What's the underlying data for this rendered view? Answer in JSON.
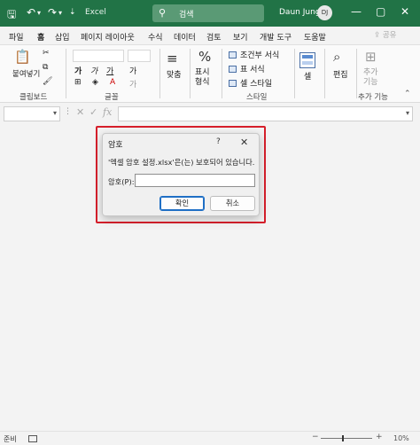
{
  "titlebar": {
    "app_name": "Excel",
    "search_placeholder": "검색",
    "user_name": "Daun Jung",
    "avatar_initials": "DJ"
  },
  "menu": {
    "items": [
      "파일",
      "홈",
      "삽입",
      "페이지 레이아웃",
      "수식",
      "데이터",
      "검토",
      "보기",
      "개발 도구",
      "도움말"
    ],
    "active": "홈",
    "share_label": "공유"
  },
  "ribbon": {
    "paste_label": "붙여넣기",
    "clipboard_label": "클립보드",
    "font_group_label": "글꼴",
    "font_buttons": [
      "가",
      "가",
      "가",
      "가"
    ],
    "align_label": "맞춤",
    "number_label": "표시 형식",
    "styles": [
      "조건부 서식",
      "표 서식",
      "셀 스타일"
    ],
    "styles_group_label": "스타일",
    "cell_label": "셀",
    "edit_label": "편집",
    "addin_label": "추가 기능",
    "addin_group_label": "추가 기능"
  },
  "formulabar": {
    "fx_label": "fx"
  },
  "dialog": {
    "title": "암호",
    "help": "?",
    "message": "'엑셀 암호 설정.xlsx'은(는) 보호되어 있습니다.",
    "password_label": "암호(P):",
    "password_value": "",
    "ok_label": "확인",
    "cancel_label": "취소"
  },
  "statusbar": {
    "status": "준비",
    "zoom": "10%"
  }
}
